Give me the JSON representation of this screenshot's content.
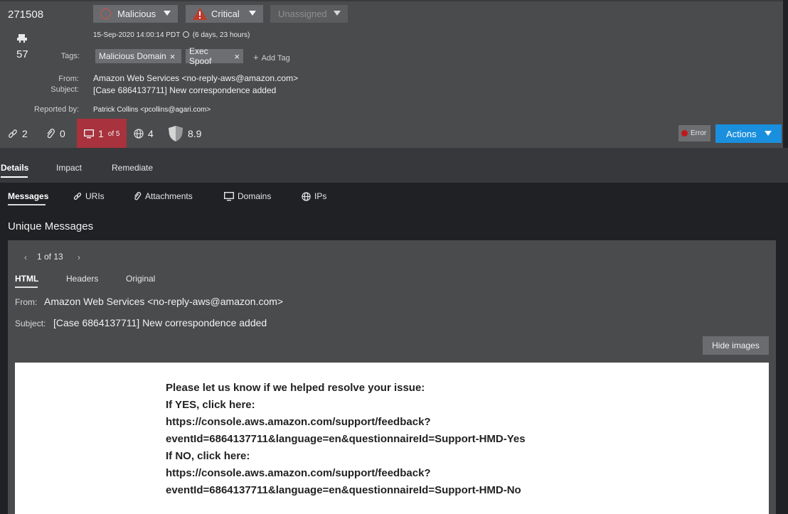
{
  "case": {
    "id": "271508",
    "message_count": "57"
  },
  "dropdowns": {
    "verdict": "Malicious",
    "severity": "Critical",
    "assignee": "Unassigned"
  },
  "timestamp": "15-Sep-2020 14:00:14 PDT",
  "age": "(6 days, 23 hours)",
  "tags": {
    "label": "Tags:",
    "items": [
      "Malicious Domain",
      "Exec Spoof"
    ],
    "add_label": "Add Tag"
  },
  "header_fields": {
    "from_label": "From:",
    "from_value": "Amazon Web Services <no-reply-aws@amazon.com>",
    "subject_label": "Subject:",
    "subject_value": "[Case 6864137711] New correspondence added",
    "reported_label": "Reported by:",
    "reported_value": "Patrick Collins <pcollins@agari.com>"
  },
  "stats": {
    "links": "2",
    "attachments": "0",
    "devices": "1",
    "devices_of": "of 5",
    "globe": "4",
    "score": "8.9"
  },
  "status": {
    "error_label": "Error",
    "actions_label": "Actions"
  },
  "colors": {
    "critical": "#c0392b",
    "devices_highlight": "#a8323d",
    "actions": "#1a8fde",
    "error_dot": "#c01818"
  },
  "top_tabs": [
    "Details",
    "Impact",
    "Remediate"
  ],
  "sub_tabs": [
    "Messages",
    "URIs",
    "Attachments",
    "Domains",
    "IPs"
  ],
  "section_title": "Unique Messages",
  "pager": {
    "text": "1 of 13"
  },
  "message_tabs": [
    "HTML",
    "Headers",
    "Original"
  ],
  "message": {
    "from_label": "From:",
    "from_value": "Amazon Web Services <no-reply-aws@amazon.com>",
    "subject_label": "Subject:",
    "subject_value": "[Case 6864137711] New correspondence added",
    "hide_images_label": "Hide images",
    "body_lines": [
      "Please let us know if we helped resolve your issue:",
      "If YES, click here:",
      "https://console.aws.amazon.com/support/feedback?",
      "eventId=6864137711&language=en&questionnaireId=Support-HMD-Yes",
      "If NO, click here:",
      "https://console.aws.amazon.com/support/feedback?",
      "eventId=6864137711&language=en&questionnaireId=Support-HMD-No"
    ]
  },
  "icons": [
    "messages-icon",
    "malicious-circle-icon",
    "warning-triangle-icon",
    "clock-icon",
    "link-icon",
    "paperclip-icon",
    "monitor-icon",
    "globe-icon",
    "shield-icon",
    "chevron-left-icon",
    "chevron-right-icon"
  ]
}
